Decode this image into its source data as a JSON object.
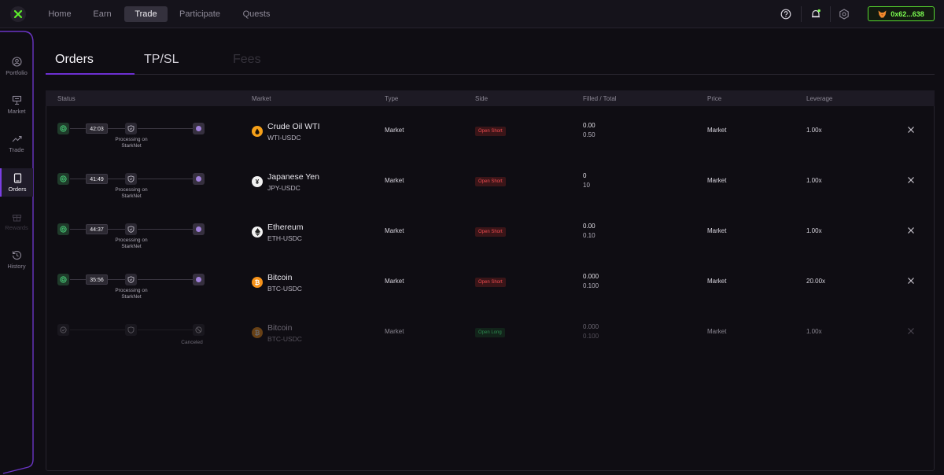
{
  "nav": {
    "items": [
      {
        "label": "Home",
        "active": false
      },
      {
        "label": "Earn",
        "active": false
      },
      {
        "label": "Trade",
        "active": true
      },
      {
        "label": "Participate",
        "active": false
      },
      {
        "label": "Quests",
        "active": false
      }
    ],
    "wallet_address": "0x62...638"
  },
  "sidebar": {
    "items": [
      {
        "label": "Portfolio",
        "icon": "portfolio-icon",
        "state": "normal"
      },
      {
        "label": "Market",
        "icon": "market-icon",
        "state": "normal"
      },
      {
        "label": "Trade",
        "icon": "trade-icon",
        "state": "normal"
      },
      {
        "label": "Orders",
        "icon": "orders-icon",
        "state": "active"
      },
      {
        "label": "Rewards",
        "icon": "gift-icon",
        "state": "disabled"
      },
      {
        "label": "History",
        "icon": "history-icon",
        "state": "normal"
      }
    ]
  },
  "tabs": [
    {
      "label": "Orders",
      "active": true
    },
    {
      "label": "TP/SL",
      "active": false
    },
    {
      "label": "Fees",
      "active": false,
      "disabled": true
    }
  ],
  "table": {
    "columns": [
      "Status",
      "Market",
      "Type",
      "Side",
      "Filled / Total",
      "Price",
      "Leverage"
    ],
    "rows": [
      {
        "timer": "42:03",
        "processing": "Processing on StarkNet",
        "market_name": "Crude Oil WTI",
        "market_symbol": "WTI-USDC",
        "icon": "oil-drop-icon",
        "icon_color": "#f6a019",
        "type": "Market",
        "side": "Open Short",
        "filled": "0.00",
        "total": "0.50",
        "price": "Market",
        "leverage": "1.00x",
        "status": "processing"
      },
      {
        "timer": "41:49",
        "processing": "Processing on StarkNet",
        "market_name": "Japanese Yen",
        "market_symbol": "JPY-USDC",
        "icon": "yen-icon",
        "icon_color": "#f2f2f2",
        "type": "Market",
        "side": "Open Short",
        "filled": "0",
        "total": "10",
        "price": "Market",
        "leverage": "1.00x",
        "status": "processing"
      },
      {
        "timer": "44:37",
        "processing": "Processing on StarkNet",
        "market_name": "Ethereum",
        "market_symbol": "ETH-USDC",
        "icon": "ethereum-icon",
        "icon_color": "#f2f2f2",
        "type": "Market",
        "side": "Open Short",
        "filled": "0.00",
        "total": "0.10",
        "price": "Market",
        "leverage": "1.00x",
        "status": "processing"
      },
      {
        "timer": "35:56",
        "processing": "Processing on StarkNet",
        "market_name": "Bitcoin",
        "market_symbol": "BTC-USDC",
        "icon": "bitcoin-icon",
        "icon_color": "#f7931a",
        "type": "Market",
        "side": "Open Short",
        "filled": "0.000",
        "total": "0.100",
        "price": "Market",
        "leverage": "20.00x",
        "status": "processing"
      },
      {
        "timer": "",
        "processing": "Canceled",
        "market_name": "Bitcoin",
        "market_symbol": "BTC-USDC",
        "icon": "bitcoin-icon",
        "icon_color": "#f7931a",
        "type": "Market",
        "side": "Open Long",
        "filled": "0.000",
        "total": "0.100",
        "price": "Market",
        "leverage": "1.00x",
        "status": "canceled"
      }
    ]
  }
}
